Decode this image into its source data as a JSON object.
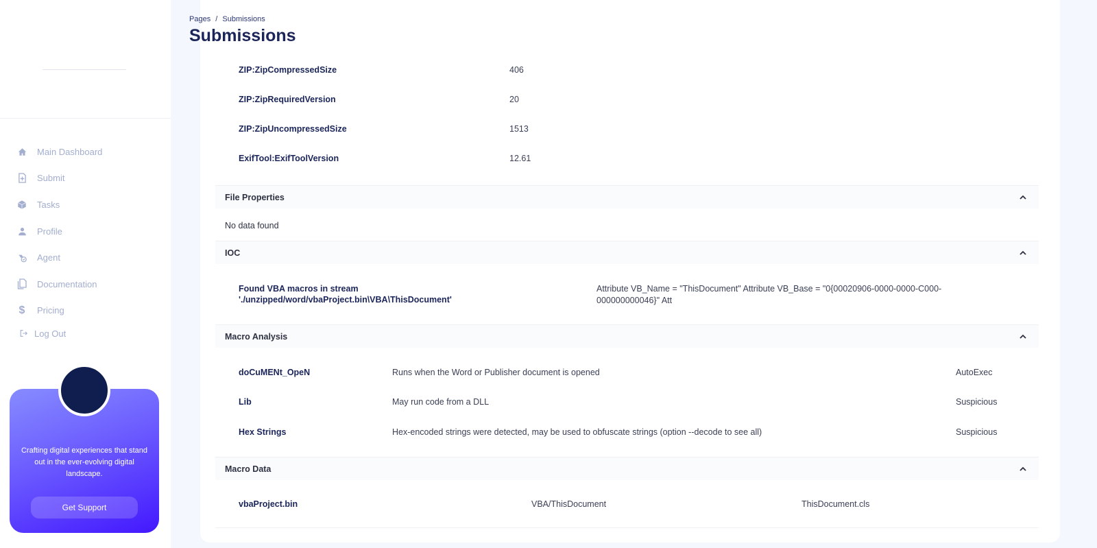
{
  "breadcrumb": {
    "parent": "Pages",
    "separator": "/",
    "current": "Submissions"
  },
  "page_title": "Submissions",
  "sidebar": {
    "items": [
      {
        "label": "Main Dashboard",
        "icon": "home-icon"
      },
      {
        "label": "Submit",
        "icon": "file-plus-icon"
      },
      {
        "label": "Tasks",
        "icon": "cube-icon"
      },
      {
        "label": "Profile",
        "icon": "user-icon"
      },
      {
        "label": "Agent",
        "icon": "agent-icon"
      },
      {
        "label": "Documentation",
        "icon": "documents-icon"
      },
      {
        "label": "Pricing",
        "icon": "dollar-icon"
      }
    ],
    "logout": {
      "label": "Log Out",
      "icon": "logout-icon"
    },
    "promo": {
      "text": "Crafting digital experiences that stand out in the ever-evolving digital landscape.",
      "button": "Get Support"
    }
  },
  "metadata_rows": [
    {
      "key": "ZIP:ZipCompressedSize",
      "value": "406"
    },
    {
      "key": "ZIP:ZipRequiredVersion",
      "value": "20"
    },
    {
      "key": "ZIP:ZipUncompressedSize",
      "value": "1513"
    },
    {
      "key": "ExifTool:ExifToolVersion",
      "value": "12.61"
    }
  ],
  "sections": {
    "file_properties": {
      "title": "File Properties",
      "empty": "No data found"
    },
    "ioc": {
      "title": "IOC",
      "rows": [
        {
          "label_line1": "Found VBA macros in stream",
          "label_line2": "'./unzipped/word/vbaProject.bin\\VBA\\ThisDocument'",
          "value_line1": "Attribute VB_Name = \"ThisDocument\" Attribute VB_Base = \"0{00020906-0000-0000-C000-",
          "value_line2": "000000000046}\" Att"
        }
      ]
    },
    "macro_analysis": {
      "title": "Macro Analysis",
      "rows": [
        {
          "keyword": "doCuMENt_OpeN",
          "description": "Runs when the Word or Publisher document is opened",
          "type": "AutoExec"
        },
        {
          "keyword": "Lib",
          "description": "May run code from a DLL",
          "type": "Suspicious"
        },
        {
          "keyword": "Hex Strings",
          "description": "Hex-encoded strings were detected, may be used to obfuscate strings (option --decode to see all)",
          "type": "Suspicious"
        }
      ]
    },
    "macro_data": {
      "title": "Macro Data",
      "rows": [
        {
          "file": "vbaProject.bin",
          "stream": "VBA/ThisDocument",
          "name": "ThisDocument.cls"
        }
      ]
    }
  },
  "colors": {
    "accent": "#4318ff",
    "title": "#1b2559",
    "muted": "#a3aed0",
    "background": "#f4f7fe"
  }
}
